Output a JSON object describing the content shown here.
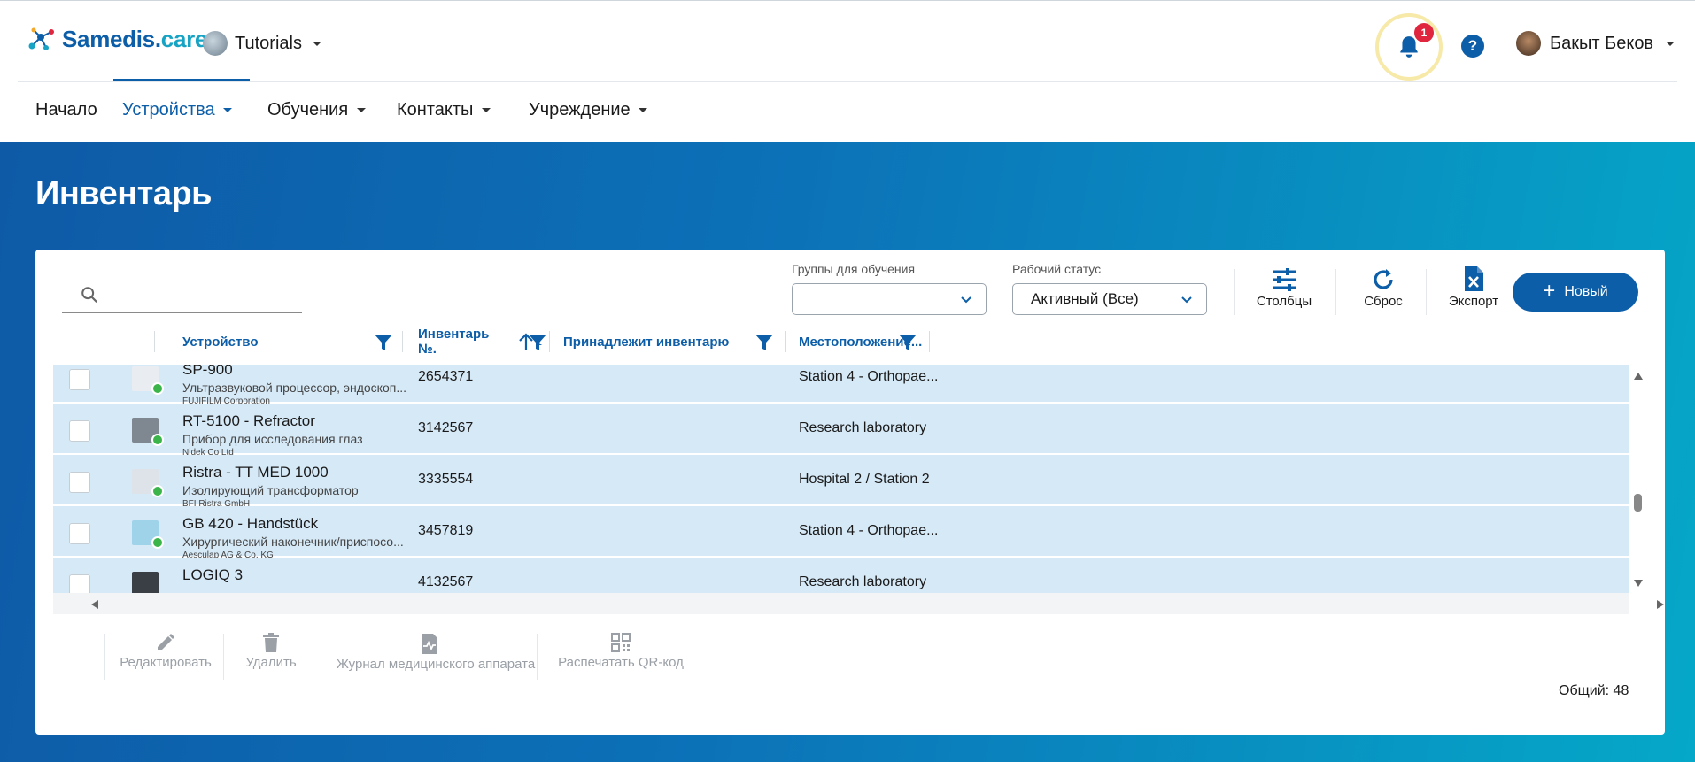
{
  "app": {
    "brand_main": "Samedis.",
    "brand_suffix": "care"
  },
  "tenant": {
    "name": "Tutorials"
  },
  "notifications": {
    "count": "1"
  },
  "help": {
    "label": "?"
  },
  "user": {
    "name": "Бакыт Беков"
  },
  "nav": {
    "items": [
      {
        "label": "Начало"
      },
      {
        "label": "Устройства"
      },
      {
        "label": "Обучения"
      },
      {
        "label": "Контакты"
      },
      {
        "label": "Учреждение"
      }
    ]
  },
  "page": {
    "title": "Инвентарь"
  },
  "search": {
    "placeholder": ""
  },
  "filters": {
    "training_groups": {
      "label": "Группы для обучения",
      "value": ""
    },
    "work_status": {
      "label": "Рабочий статус",
      "value": "Активный (Все)"
    }
  },
  "toolbar": {
    "columns_label": "Столбцы",
    "reset_label": "Сброс",
    "export_label": "Экспорт",
    "new_label": "Новый"
  },
  "table": {
    "columns": [
      {
        "label": "Устройство"
      },
      {
        "label": "Инвентарь №.",
        "sort_index": "1"
      },
      {
        "label": "Принадлежит инвентарю"
      },
      {
        "label": "Местоположение..."
      }
    ],
    "rows": [
      {
        "name": "SP-900",
        "type": "Ультразвуковой процессор, эндоскоп...",
        "manufacturer": "FUJIFILM Corporation",
        "inventory_no": "2654371",
        "location": "Station 4 - Orthopae...",
        "thumb_color": "#e9edf1"
      },
      {
        "name": "RT-5100 - Refractor",
        "type": "Прибор для исследования глаз",
        "manufacturer": "Nidek Co Ltd",
        "inventory_no": "3142567",
        "location": "Research laboratory",
        "thumb_color": "#7f8890"
      },
      {
        "name": "Ristra - TT MED 1000",
        "type": "Изолирующий трансформатор",
        "manufacturer": "BFI Ristra GmbH",
        "inventory_no": "3335554",
        "location": "Hospital 2 / Station 2",
        "thumb_color": "#dde3e8"
      },
      {
        "name": "GB 420 - Handstück",
        "type": "Хирургический наконечник/приспосо...",
        "manufacturer": "Aesculap AG & Co. KG",
        "inventory_no": "3457819",
        "location": "Station 4 - Orthopae...",
        "thumb_color": "#9fd3ea"
      },
      {
        "name": "LOGIQ 3",
        "type": "",
        "manufacturer": "",
        "inventory_no": "4132567",
        "location": "Research laboratory",
        "thumb_color": "#3a3f46"
      }
    ]
  },
  "footer": {
    "edit_label": "Редактировать",
    "delete_label": "Удалить",
    "log_label": "Журнал медицинского аппарата",
    "qr_label": "Распечатать QR-код",
    "total_label": "Общий: 48"
  },
  "colors": {
    "primary": "#0d5ea8",
    "accent": "#17a3c4",
    "row_selected": "#d6e9f7",
    "status_ok": "#3bb54a",
    "badge": "#e0253f"
  }
}
